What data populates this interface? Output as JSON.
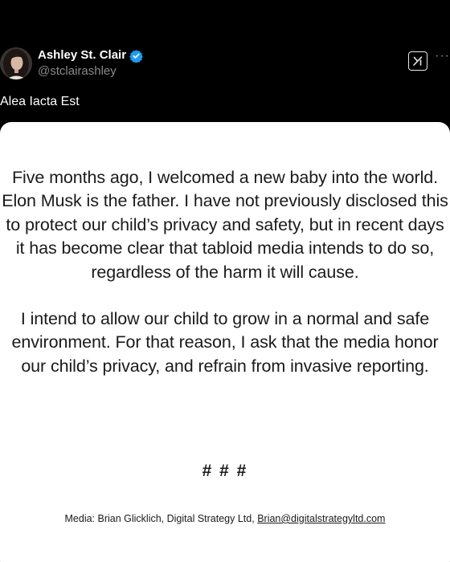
{
  "post": {
    "author_name": "Ashley St. Clair",
    "handle": "@stclairashley",
    "text": "Alea Iacta Est"
  },
  "icons": {
    "verified": "verified-badge-icon",
    "grok": "grok-icon",
    "more": "more-options-icon"
  },
  "statement": {
    "paragraph1": "Five months ago, I welcomed a new baby into the world. Elon Musk is the father. I have not previously disclosed this to protect our child’s privacy and safety, but in recent days it has become clear that tabloid media intends to do so, regardless of the harm it will cause.",
    "paragraph2": "I intend to allow our child to grow in a normal and safe environment. For that reason, I ask that the media honor our child’s privacy, and refrain from invasive reporting.",
    "separator": "# # #",
    "contact_prefix": "Media: Brian Glicklich, Digital Strategy Ltd, ",
    "contact_email": "Brian@digitalstrategyltd.com"
  },
  "colors": {
    "background": "#000000",
    "verified_blue": "#1d9bf0",
    "handle_gray": "#8b8b8b",
    "card_background": "#ffffff"
  }
}
